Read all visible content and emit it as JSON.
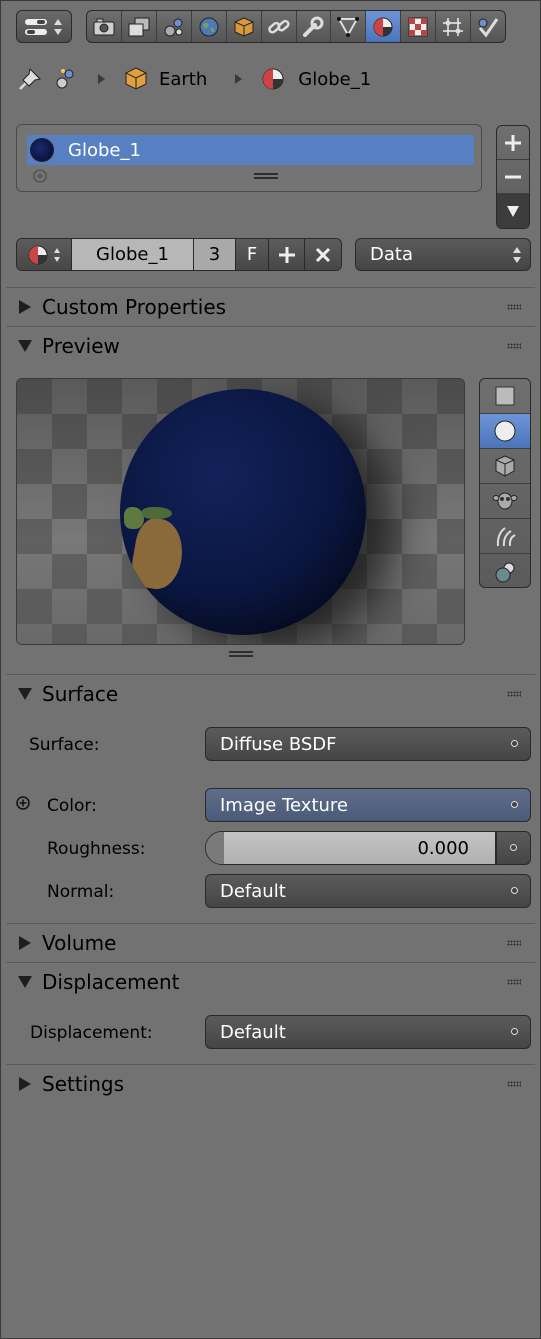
{
  "toolbar": {
    "editor_icon": "properties-editor-icon",
    "tabs": [
      {
        "name": "render-icon"
      },
      {
        "name": "render-layers-icon"
      },
      {
        "name": "scene-icon"
      },
      {
        "name": "world-icon"
      },
      {
        "name": "object-icon"
      },
      {
        "name": "constraints-icon"
      },
      {
        "name": "modifiers-icon"
      },
      {
        "name": "data-icon"
      },
      {
        "name": "material-icon",
        "active": true
      },
      {
        "name": "texture-icon"
      },
      {
        "name": "particles-icon"
      },
      {
        "name": "physics-icon"
      }
    ]
  },
  "breadcrumb": {
    "object": "Earth",
    "material": "Globe_1"
  },
  "slots": {
    "items": [
      {
        "label": "Globe_1"
      }
    ],
    "add": "+",
    "remove": "−"
  },
  "material_id": {
    "name": "Globe_1",
    "users": "3",
    "fake_user": "F",
    "link": "Data"
  },
  "panels": {
    "custom_properties": "Custom Properties",
    "preview": "Preview",
    "surface": "Surface",
    "volume": "Volume",
    "displacement": "Displacement",
    "settings": "Settings"
  },
  "surface": {
    "surface_label": "Surface:",
    "surface_value": "Diffuse BSDF",
    "color_label": "Color:",
    "color_value": "Image Texture",
    "roughness_label": "Roughness:",
    "roughness_value": "0.000",
    "normal_label": "Normal:",
    "normal_value": "Default"
  },
  "displacement": {
    "label": "Displacement:",
    "value": "Default"
  },
  "colors": {
    "background": "#727272",
    "accent": "#5680c2"
  }
}
